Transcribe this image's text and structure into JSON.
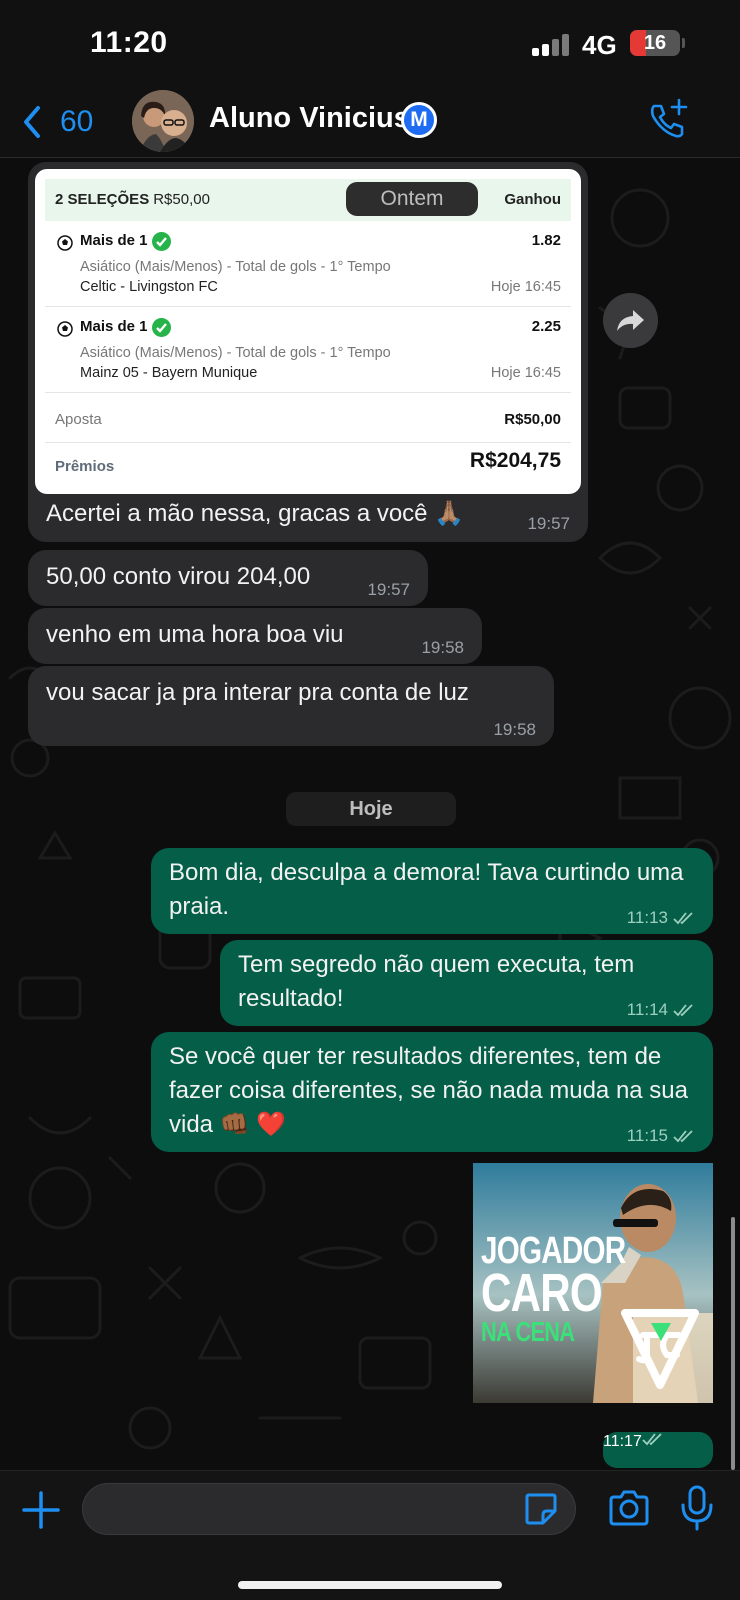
{
  "status_bar": {
    "time": "11:20",
    "network": "4G",
    "battery": "16"
  },
  "header": {
    "back_count": "60",
    "contact_name": "Aluno Vinicius",
    "badge_letter": "M"
  },
  "bet": {
    "selections_label": "2 SELEÇÕES",
    "selections_amount": "R$50,00",
    "result": "Ganhou",
    "date_overlay": "Ontem",
    "legs": [
      {
        "title": "Mais de 1",
        "odd": "1.82",
        "market": "Asiático (Mais/Menos) - Total de gols - 1° Tempo",
        "match": "Celtic - Livingston FC",
        "when": "Hoje 16:45"
      },
      {
        "title": "Mais de 1",
        "odd": "2.25",
        "market": "Asiático (Mais/Menos) - Total de gols - 1° Tempo",
        "match": "Mainz 05 - Bayern Munique",
        "when": "Hoje 16:45"
      }
    ],
    "stake_label": "Aposta",
    "stake_value": "R$50,00",
    "prize_label": "Prêmios",
    "prize_value": "R$204,75"
  },
  "messages": [
    {
      "direction": "in",
      "text": "Acertei a mão nessa, gracas a você 🙏🏽",
      "time": "19:57"
    },
    {
      "direction": "in",
      "text": "50,00 conto virou 204,00",
      "time": "19:57"
    },
    {
      "direction": "in",
      "text": "venho em uma hora boa viu",
      "time": "19:58"
    },
    {
      "direction": "in",
      "text": "vou sacar ja pra interar pra conta de luz",
      "time": "19:58"
    },
    {
      "direction": "out",
      "text": "Bom dia, desculpa a demora! Tava curtindo uma praia.",
      "time": "11:13"
    },
    {
      "direction": "out",
      "text": "Tem segredo não quem executa, tem resultado!",
      "time": "11:14"
    },
    {
      "direction": "out",
      "text": "Se você quer ter resultados diferentes, tem de fazer coisa diferentes, se não nada muda na sua vida 👊🏾 ❤️",
      "time": "11:15"
    }
  ],
  "date_divider": "Hoje",
  "media": {
    "line1": "JOGADOR",
    "line2": "CARO",
    "line3": "NA CENA",
    "logo": "JC",
    "time": "11:17"
  },
  "input": {
    "placeholder": ""
  },
  "colors": {
    "accent": "#1e8ff0",
    "outgoing_bubble": "#055e47",
    "incoming_bubble": "#2b2b2d",
    "badge_blue": "#1d6cf2"
  },
  "icons": [
    "back-chevron-icon",
    "verified-badge-icon",
    "call-add-icon",
    "soccer-ball-icon",
    "check-icon",
    "forward-icon",
    "double-check-icon",
    "plus-icon",
    "sticker-icon",
    "camera-icon",
    "microphone-icon"
  ]
}
